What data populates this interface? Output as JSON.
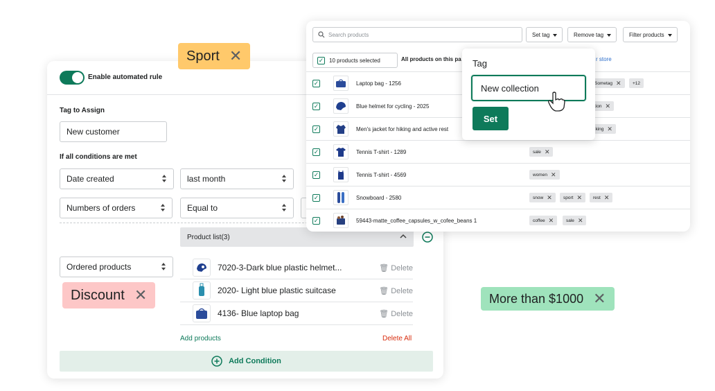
{
  "pills": {
    "sport": {
      "label": "Sport",
      "color": "#ffc96b"
    },
    "discount": {
      "label": "Discount",
      "color": "#fdc7c7"
    },
    "more": {
      "label": "More than $1000",
      "color": "#9fe3bc"
    }
  },
  "rule_form": {
    "toggle_label": "Enable automated rule",
    "tag_label": "Tag to Assign",
    "tag_value": "New customer",
    "conditions_label": "If all conditions are met",
    "row1": {
      "field": "Date created",
      "value": "last month"
    },
    "row2": {
      "field": "Numbers of orders",
      "operator": "Equal to"
    },
    "row3": {
      "field": "Ordered products"
    },
    "product_list": {
      "header": "Product list(3)",
      "items": [
        {
          "name": "7020-3-Dark blue plastic helmet...",
          "delete": "Delete",
          "icon": "helmet-icon"
        },
        {
          "name": "2020- Light blue plastic suitcase",
          "delete": "Delete",
          "icon": "suitcase-icon"
        },
        {
          "name": "4136- Blue laptop bag",
          "delete": "Delete",
          "icon": "bag-icon"
        }
      ],
      "add_label": "Add products",
      "delete_all_label": "Delete All"
    },
    "add_condition_label": "Add Condition",
    "accent": "#0e7a5a",
    "danger": "#d82c0d"
  },
  "products_panel": {
    "search_placeholder": "Search products",
    "buttons": {
      "set_tag": "Set tag",
      "remove_tag": "Remove tag",
      "filter": "Filter products"
    },
    "selected_label": "10 products selected",
    "all_products_label": "All products on this pa",
    "store_label": "r store",
    "rows": [
      {
        "name": "Laptop bag - 1256",
        "tags": [
          "Sometag"
        ],
        "extra": "+12"
      },
      {
        "name": "Blue helmet for cycling - 2025",
        "tags": [
          "tion"
        ]
      },
      {
        "name": "Men's jacket for hiking and active rest",
        "tags": [
          "iking"
        ]
      },
      {
        "name": "Tennis T-shirt - 1289",
        "tags": [
          "sale"
        ]
      },
      {
        "name": "Tennis T-shirt - 4569",
        "tags": [
          "women"
        ]
      },
      {
        "name": "Snowboard - 2580",
        "tags": [
          "snow",
          "sport",
          "rest"
        ]
      },
      {
        "name": "59443-matte_coffee_capsules_w_cofee_beans 1",
        "tags": [
          "coffee",
          "sale"
        ]
      }
    ]
  },
  "tag_popover": {
    "label": "Tag",
    "input_value": "New collection",
    "set_label": "Set"
  }
}
